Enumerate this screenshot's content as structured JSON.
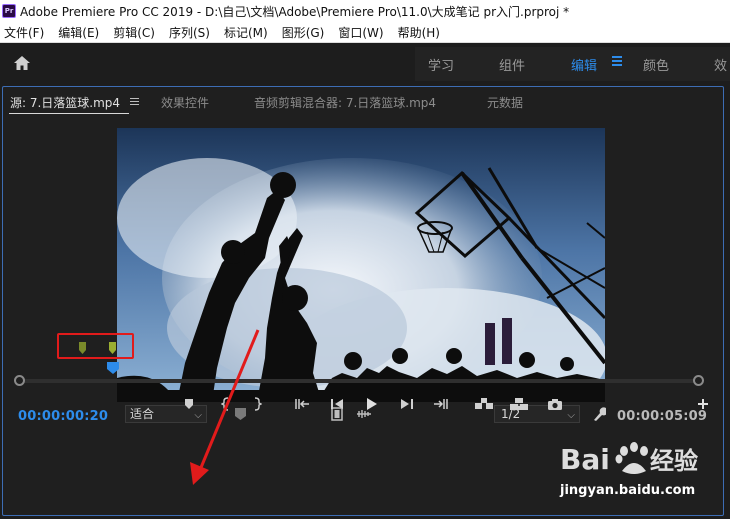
{
  "window": {
    "title": "Adobe Premiere Pro CC 2019 - D:\\自己\\文档\\Adobe\\Premiere Pro\\11.0\\大成笔记 pr入门.prproj *",
    "logo_text": "Pr"
  },
  "menu": [
    "文件(F)",
    "编辑(E)",
    "剪辑(C)",
    "序列(S)",
    "标记(M)",
    "图形(G)",
    "窗口(W)",
    "帮助(H)"
  ],
  "workspaces": {
    "tabs": [
      "学习",
      "组件",
      "编辑",
      "颜色",
      "效"
    ],
    "active": "编辑"
  },
  "source_panel": {
    "tabs": [
      "源: 7.日落篮球.mp4",
      "效果控件",
      "音频剪辑混合器: 7.日落篮球.mp4",
      "元数据"
    ],
    "playhead_timecode": "00:00:00:20",
    "fit_option": "适合",
    "resolution": "1/2",
    "duration_timecode": "00:00:05:09"
  },
  "watermark": {
    "brand": "Baidu经验",
    "url": "jingyan.baidu.com"
  },
  "colors": {
    "accent": "#2d8ceb",
    "annotation_red": "#e11b1b",
    "marker_green": "#7a8a2a"
  },
  "icons": {
    "home": "home-icon",
    "add_marker": "marker-icon",
    "mark_in": "mark-in-icon",
    "mark_out": "mark-out-icon",
    "go_to_in": "go-to-in-icon",
    "step_back": "step-back-icon",
    "play": "play-icon",
    "step_forward": "step-forward-icon",
    "go_to_out": "go-to-out-icon",
    "insert": "insert-icon",
    "overwrite": "overwrite-icon",
    "export_frame": "camera-icon",
    "add": "plus-icon"
  }
}
